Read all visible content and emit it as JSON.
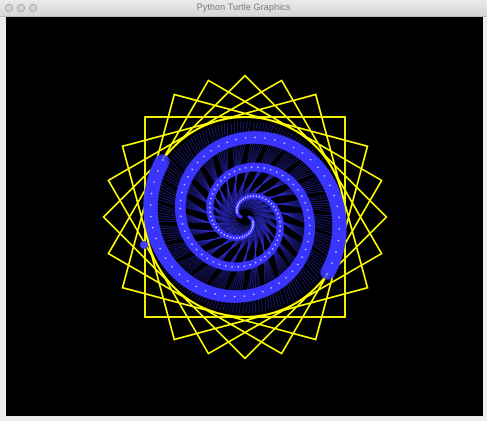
{
  "window": {
    "title": "Python Turtle Graphics",
    "buttons": {
      "close": "close",
      "minimize": "minimize",
      "zoom": "zoom"
    }
  },
  "canvas": {
    "background": "#000000",
    "pattern": {
      "square_color": "#ffff00",
      "square_count": 24,
      "circle_color": "#ffff00",
      "spiral_color": "#3a35ff",
      "spiral_arms": 2,
      "spiral_accent": "#ffffff",
      "turtle_color": "#4040ff"
    }
  }
}
